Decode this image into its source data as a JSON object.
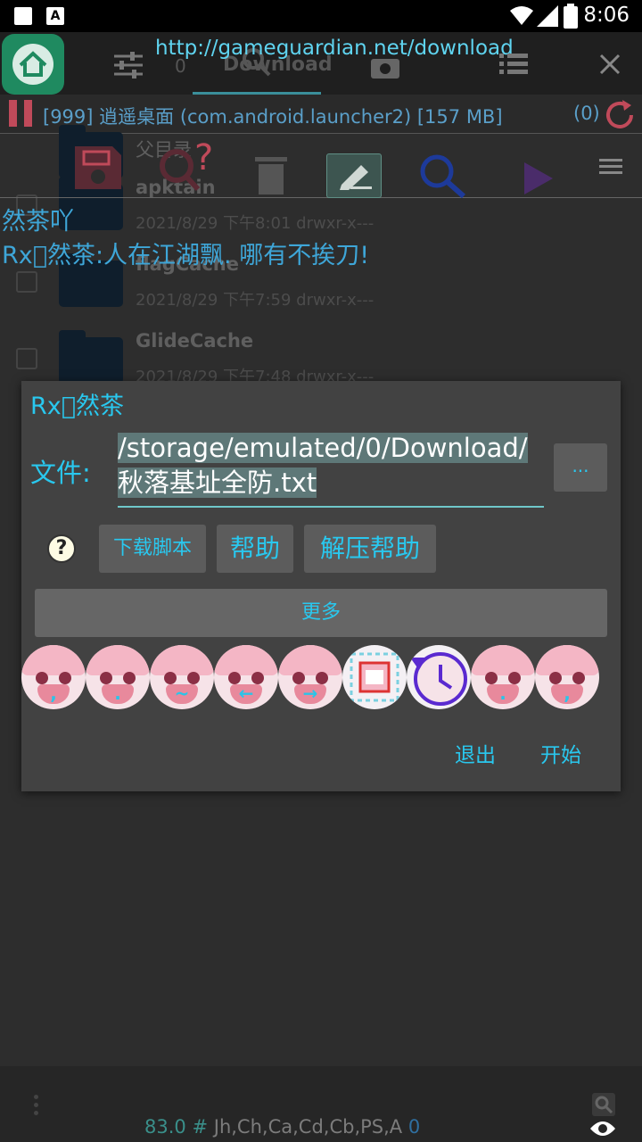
{
  "status_bar": {
    "time": "8:06"
  },
  "toolbar": {
    "url": "http://gameguardian.net/download",
    "tab_label": "Download",
    "tab_count": "0"
  },
  "process": {
    "label": "[999] 逍遥桌面 (com.android.launcher2) [157 MB]",
    "count": "(0)"
  },
  "files": [
    {
      "name": "父目录",
      "meta": ""
    },
    {
      "name": "apktain",
      "meta": "2021/8/29 下午8:01   drwxr-x---"
    },
    {
      "name": "flagCache",
      "meta": "2021/8/29 下午7:59   drwxr-x---"
    },
    {
      "name": "GlideCache",
      "meta": "2021/8/29 下午7:48   drwxr-x---"
    }
  ],
  "overlay": {
    "line1": "然茶吖",
    "line2": "Rx\u0000然茶:人在江湖飘. 哪有不挨刀!"
  },
  "dialog": {
    "title": "Rx\u0000然茶",
    "file_label": "文件:",
    "file_value_line1": "/storage/emulated/0/Download/",
    "file_value_line2": "秋落基址全防.txt",
    "browse_label": "...",
    "help_glyph": "?",
    "download_script": "下载脚本",
    "help": "帮助",
    "unzip_help": "解压帮助",
    "more": "更多",
    "avatar_marks": [
      ",",
      ".",
      "~",
      "←",
      "→",
      "",
      "",
      ".",
      ","
    ],
    "exit": "退出",
    "start": "开始"
  },
  "bottom": {
    "value": "83.0",
    "hash": "#",
    "regions": "Jh,Ch,Ca,Cd,Cb,PS,A",
    "count": "0"
  }
}
